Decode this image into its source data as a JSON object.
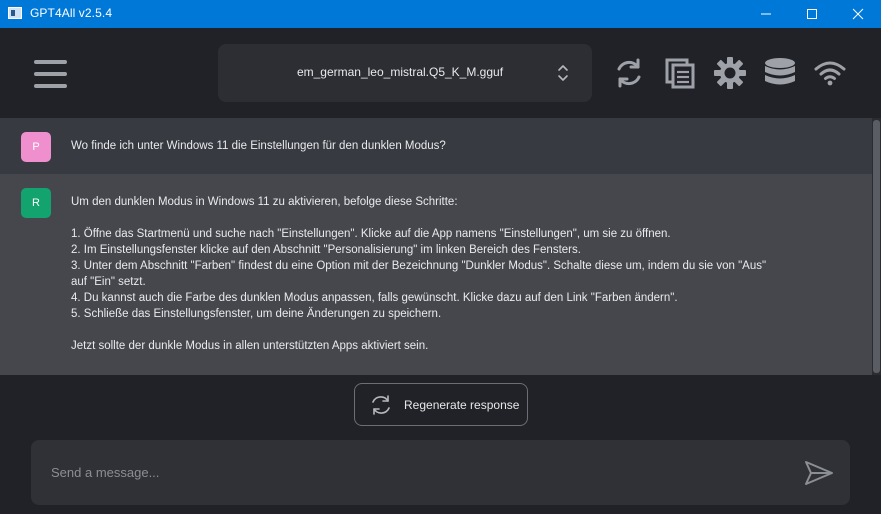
{
  "window": {
    "title": "GPT4All v2.5.4",
    "controls": [
      "minimize",
      "maximize",
      "close"
    ]
  },
  "header": {
    "menu_icon": "hamburger-menu-icon",
    "model": {
      "selected": "em_german_leo_mistral.Q5_K_M.gguf"
    },
    "icons": [
      "reset-chat-icon",
      "copy-chat-icon",
      "settings-gear-icon",
      "database-localdocs-icon",
      "wifi-network-icon"
    ]
  },
  "chat": {
    "messages": [
      {
        "role": "prompt",
        "avatar": "P",
        "avatar_color": "#f08fce",
        "text": "Wo finde ich unter Windows 11 die Einstellungen für den dunklen Modus?"
      },
      {
        "role": "response",
        "avatar": "R",
        "avatar_color": "#13a36e",
        "intro": "Um den dunklen Modus in Windows 11 zu aktivieren, befolge diese Schritte:",
        "steps": [
          "1. Öffne das Startmenü und suche nach \"Einstellungen\". Klicke auf die App namens \"Einstellungen\", um sie zu öffnen.",
          "2. Im Einstellungsfenster klicke auf den Abschnitt \"Personalisierung\" im linken Bereich des Fensters.",
          "3. Unter dem Abschnitt \"Farben\" findest du eine Option mit der Bezeichnung \"Dunkler Modus\". Schalte diese um, indem du sie von \"Aus\" auf \"Ein\" setzt.",
          "4. Du kannst auch die Farbe des dunklen Modus anpassen, falls gewünscht. Klicke dazu auf den Link \"Farben ändern\".",
          "5. Schließe das Einstellungsfenster, um deine Änderungen zu speichern."
        ],
        "outro": "Jetzt sollte der dunkle Modus in allen unterstützten Apps aktiviert sein."
      }
    ]
  },
  "regenerate": {
    "label": "Regenerate response",
    "icon": "regenerate-icon"
  },
  "input": {
    "placeholder": "Send a message...",
    "value": "",
    "send_icon": "send-icon"
  },
  "colors": {
    "titlebar": "#0078d7",
    "background": "#202227",
    "prompt_bg": "#373a41",
    "response_bg": "#45474d"
  }
}
